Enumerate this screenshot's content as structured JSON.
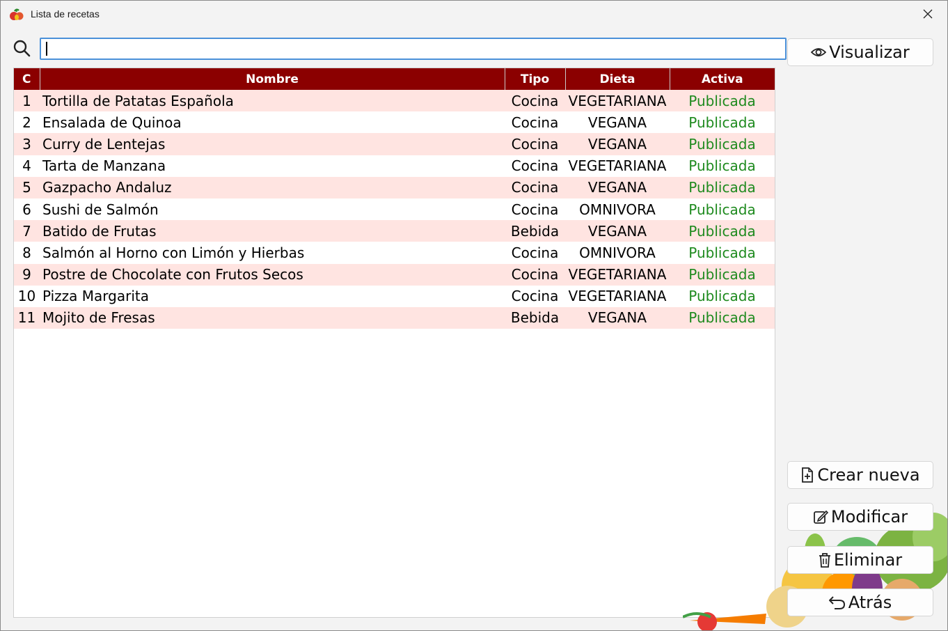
{
  "window": {
    "title": "Lista de recetas"
  },
  "search": {
    "value": "",
    "placeholder": ""
  },
  "table": {
    "columns": [
      "C",
      "Nombre",
      "Tipo",
      "Dieta",
      "Activa"
    ],
    "rows": [
      {
        "c": "1",
        "nombre": "Tortilla de Patatas Española",
        "tipo": "Cocina",
        "dieta": "VEGETARIANA",
        "activa": "Publicada"
      },
      {
        "c": "2",
        "nombre": "Ensalada de Quinoa",
        "tipo": "Cocina",
        "dieta": "VEGANA",
        "activa": "Publicada"
      },
      {
        "c": "3",
        "nombre": "Curry de Lentejas",
        "tipo": "Cocina",
        "dieta": "VEGANA",
        "activa": "Publicada"
      },
      {
        "c": "4",
        "nombre": "Tarta de Manzana",
        "tipo": "Cocina",
        "dieta": "VEGETARIANA",
        "activa": "Publicada"
      },
      {
        "c": "5",
        "nombre": "Gazpacho Andaluz",
        "tipo": "Cocina",
        "dieta": "VEGANA",
        "activa": "Publicada"
      },
      {
        "c": "6",
        "nombre": "Sushi de Salmón",
        "tipo": "Cocina",
        "dieta": "OMNIVORA",
        "activa": "Publicada"
      },
      {
        "c": "7",
        "nombre": "Batido de Frutas",
        "tipo": "Bebida",
        "dieta": "VEGANA",
        "activa": "Publicada"
      },
      {
        "c": "8",
        "nombre": "Salmón al Horno con Limón y Hierbas",
        "tipo": "Cocina",
        "dieta": "OMNIVORA",
        "activa": "Publicada"
      },
      {
        "c": "9",
        "nombre": "Postre de Chocolate con Frutos Secos",
        "tipo": "Cocina",
        "dieta": "VEGETARIANA",
        "activa": "Publicada"
      },
      {
        "c": "10",
        "nombre": "Pizza Margarita",
        "tipo": "Cocina",
        "dieta": "VEGETARIANA",
        "activa": "Publicada"
      },
      {
        "c": "11",
        "nombre": "Mojito de Fresas",
        "tipo": "Bebida",
        "dieta": "VEGANA",
        "activa": "Publicada"
      }
    ]
  },
  "buttons": {
    "visualizar": {
      "label": "Visualizar",
      "icon": "eye-icon"
    },
    "crear": {
      "label": "Crear nueva",
      "icon": "new-file-icon"
    },
    "modificar": {
      "label": "Modificar",
      "icon": "edit-icon"
    },
    "eliminar": {
      "label": "Eliminar",
      "icon": "trash-icon"
    },
    "atras": {
      "label": "Atrás",
      "icon": "undo-arrow-icon"
    }
  },
  "colors": {
    "header_bg": "#8b0000",
    "row_odd_bg": "#ffe4e1",
    "status_green": "#1e8a1e",
    "search_border": "#4a90d9"
  }
}
